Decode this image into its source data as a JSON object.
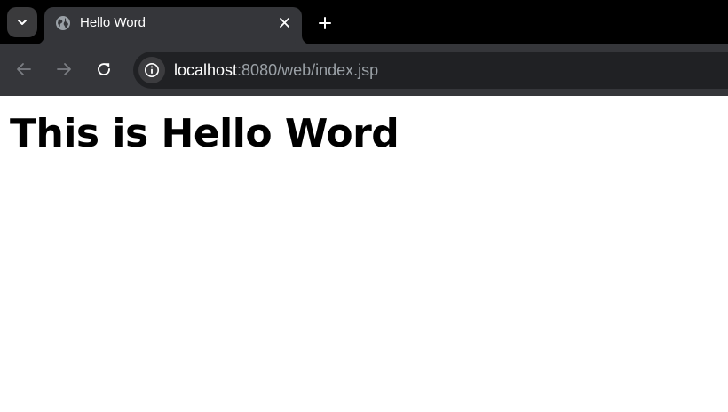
{
  "browser": {
    "tab": {
      "title": "Hello Word",
      "favicon": "globe-icon"
    },
    "address_bar": {
      "host": "localhost",
      "rest": ":8080/web/index.jsp"
    },
    "icons": {
      "tab_search": "chevron-down-icon",
      "tab_close": "close-icon",
      "new_tab": "plus-icon",
      "back": "arrow-left-icon",
      "forward": "arrow-right-icon",
      "reload": "reload-icon",
      "site_info": "info-icon"
    },
    "colors": {
      "tab_strip": "#000000",
      "toolbar": "#35363a",
      "omnibox": "#202124",
      "url_host": "#ffffff",
      "url_rest": "#9aa0a6"
    }
  },
  "page": {
    "heading": "This is Hello Word"
  }
}
